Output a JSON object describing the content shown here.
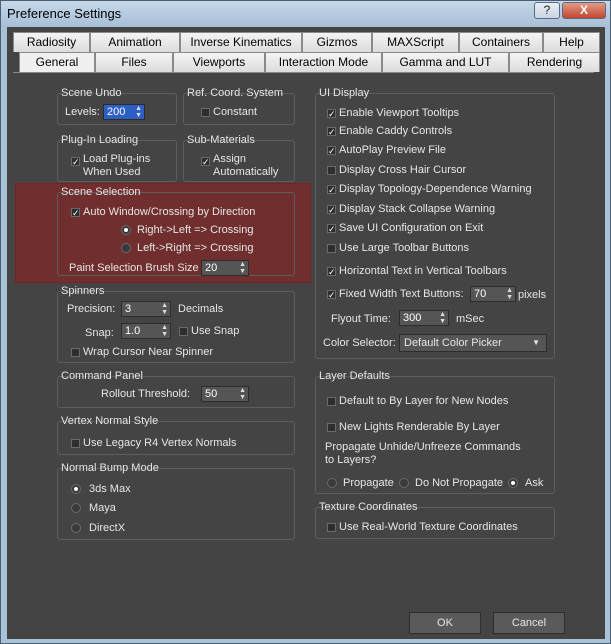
{
  "window": {
    "title": "Preference Settings",
    "help_label": "?",
    "close_label": "X"
  },
  "tabs_row1": [
    "Radiosity",
    "Animation",
    "Inverse Kinematics",
    "Gizmos",
    "MAXScript",
    "Containers",
    "Help"
  ],
  "tabs_row2": [
    "General",
    "Files",
    "Viewports",
    "Interaction Mode",
    "Gamma and LUT",
    "Rendering"
  ],
  "active_tab": "General",
  "scene_undo": {
    "title": "Scene Undo",
    "levels_label": "Levels:",
    "levels_value": "200"
  },
  "ref_coord": {
    "title": "Ref. Coord. System",
    "constant_label": "Constant"
  },
  "plugin_loading": {
    "title": "Plug-In Loading",
    "load_label_1": "Load Plug-ins",
    "load_label_2": "When Used"
  },
  "sub_materials": {
    "title": "Sub-Materials",
    "assign_label_1": "Assign",
    "assign_label_2": "Automatically"
  },
  "scene_selection": {
    "title": "Scene Selection",
    "auto_window": "Auto Window/Crossing by Direction",
    "right_left": "Right->Left => Crossing",
    "left_right": "Left->Right => Crossing",
    "brush_label": "Paint Selection Brush Size",
    "brush_value": "20"
  },
  "spinners": {
    "title": "Spinners",
    "precision_label": "Precision:",
    "precision_value": "3",
    "decimals_label": "Decimals",
    "snap_label": "Snap:",
    "snap_value": "1.0",
    "use_snap_label": "Use Snap",
    "wrap_label": "Wrap Cursor Near Spinner"
  },
  "command_panel": {
    "title": "Command Panel",
    "rollout_label": "Rollout Threshold:",
    "rollout_value": "50"
  },
  "vertex_normal": {
    "title": "Vertex Normal Style",
    "legacy_label": "Use Legacy R4 Vertex Normals"
  },
  "normal_bump": {
    "title": "Normal Bump Mode",
    "options": [
      "3ds Max",
      "Maya",
      "DirectX"
    ]
  },
  "ui_display": {
    "title": "UI Display",
    "items": [
      {
        "label": "Enable Viewport Tooltips",
        "checked": true
      },
      {
        "label": "Enable Caddy Controls",
        "checked": true
      },
      {
        "label": "AutoPlay Preview File",
        "checked": true
      },
      {
        "label": "Display Cross Hair Cursor",
        "checked": false
      },
      {
        "label": "Display Topology-Dependence Warning",
        "checked": true
      },
      {
        "label": "Display Stack Collapse Warning",
        "checked": true
      },
      {
        "label": "Save UI Configuration on Exit",
        "checked": true
      },
      {
        "label": "Use Large Toolbar Buttons",
        "checked": false
      },
      {
        "label": "Horizontal Text in Vertical Toolbars",
        "checked": true
      }
    ],
    "fixed_width_label": "Fixed Width Text Buttons:",
    "fixed_width_value": "70",
    "pixels_label": "pixels",
    "flyout_label": "Flyout Time:",
    "flyout_value": "300",
    "msec_label": "mSec",
    "color_selector_label": "Color Selector:",
    "color_selector_value": "Default Color Picker"
  },
  "layer_defaults": {
    "title": "Layer Defaults",
    "default_by_layer": "Default to By Layer for New Nodes",
    "new_lights": "New Lights Renderable By Layer",
    "propagate_line1": "Propagate Unhide/Unfreeze Commands",
    "propagate_line2": "to Layers?",
    "propagate_options": [
      "Propagate",
      "Do Not Propagate",
      "Ask"
    ]
  },
  "texture_coords": {
    "title": "Texture Coordinates",
    "real_world_label": "Use Real-World Texture Coordinates"
  },
  "buttons": {
    "ok": "OK",
    "cancel": "Cancel"
  }
}
